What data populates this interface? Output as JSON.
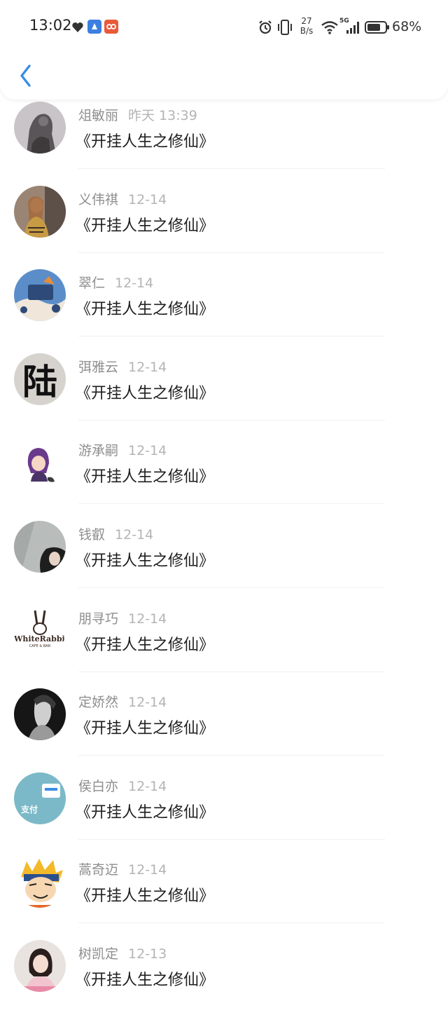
{
  "status_bar": {
    "time": "13:02",
    "net_speed_top": "27",
    "net_speed_bottom": "B/s",
    "network": "5G",
    "battery": "68%"
  },
  "header": {
    "back_icon": "chevron-left-icon",
    "accent": "#3a8ee6"
  },
  "comments": [
    {
      "name": "俎敏丽",
      "date": "昨天 13:39",
      "text": "《开挂人生之修仙》"
    },
    {
      "name": "义伟祺",
      "date": "12-14",
      "text": "《开挂人生之修仙》"
    },
    {
      "name": "翠仁",
      "date": "12-14",
      "text": "《开挂人生之修仙》"
    },
    {
      "name": "弭雅云",
      "date": "12-14",
      "text": "《开挂人生之修仙》"
    },
    {
      "name": "游承嗣",
      "date": "12-14",
      "text": "《开挂人生之修仙》"
    },
    {
      "name": "钱叡",
      "date": "12-14",
      "text": "《开挂人生之修仙》"
    },
    {
      "name": "朋寻巧",
      "date": "12-14",
      "text": "《开挂人生之修仙》"
    },
    {
      "name": "定娇然",
      "date": "12-14",
      "text": "《开挂人生之修仙》"
    },
    {
      "name": "侯白亦",
      "date": "12-14",
      "text": "《开挂人生之修仙》"
    },
    {
      "name": "蒿奇迈",
      "date": "12-14",
      "text": "《开挂人生之修仙》"
    },
    {
      "name": "树凯定",
      "date": "12-13",
      "text": "《开挂人生之修仙》"
    }
  ],
  "avatar_texts": {
    "row4": "陆",
    "row7": "WhiteRabbit",
    "row7_sub": "CAFE & BAR",
    "row9": "支付"
  }
}
